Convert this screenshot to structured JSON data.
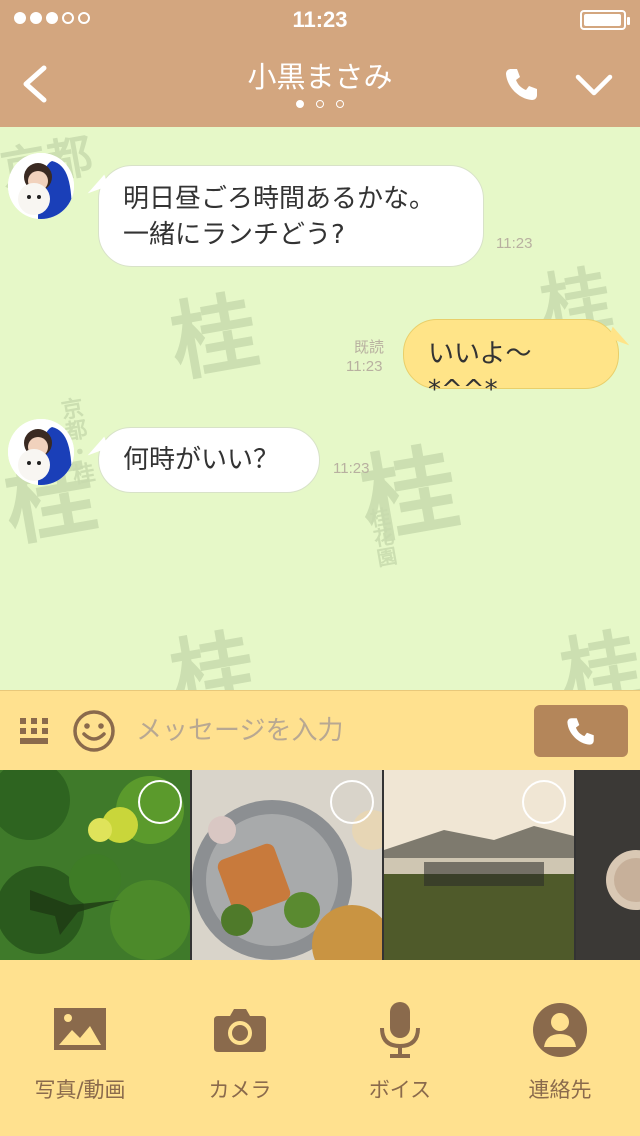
{
  "status": {
    "time": "11:23",
    "signal_bars": 3,
    "signal_total": 5
  },
  "header": {
    "contact_name": "小黒まさみ",
    "page_index": 0,
    "page_count": 3
  },
  "chat": {
    "watermark_text": [
      "京都・桂",
      "桂花園"
    ],
    "messages": [
      {
        "direction": "incoming",
        "lines": [
          "明日昼ごろ時間あるかな。",
          "一緒にランチどう?"
        ],
        "time": "11:23"
      },
      {
        "direction": "outgoing",
        "text": "いいよ〜*^^*",
        "read_label": "既読",
        "time": "11:23"
      },
      {
        "direction": "incoming",
        "text": "何時がいい？",
        "time": "11:23"
      }
    ]
  },
  "input": {
    "placeholder": "メッセージを入力"
  },
  "tabs": [
    {
      "label": "写真/動画",
      "icon": "image-icon"
    },
    {
      "label": "カメラ",
      "icon": "camera-icon"
    },
    {
      "label": "ボイス",
      "icon": "microphone-icon"
    },
    {
      "label": "連絡先",
      "icon": "contact-icon"
    }
  ],
  "colors": {
    "header": "#d3a67f",
    "chat_bg": "#e6f8c8",
    "outgoing_bubble": "#ffe488",
    "bar": "#ffe18f",
    "call_button": "#b4865a"
  }
}
